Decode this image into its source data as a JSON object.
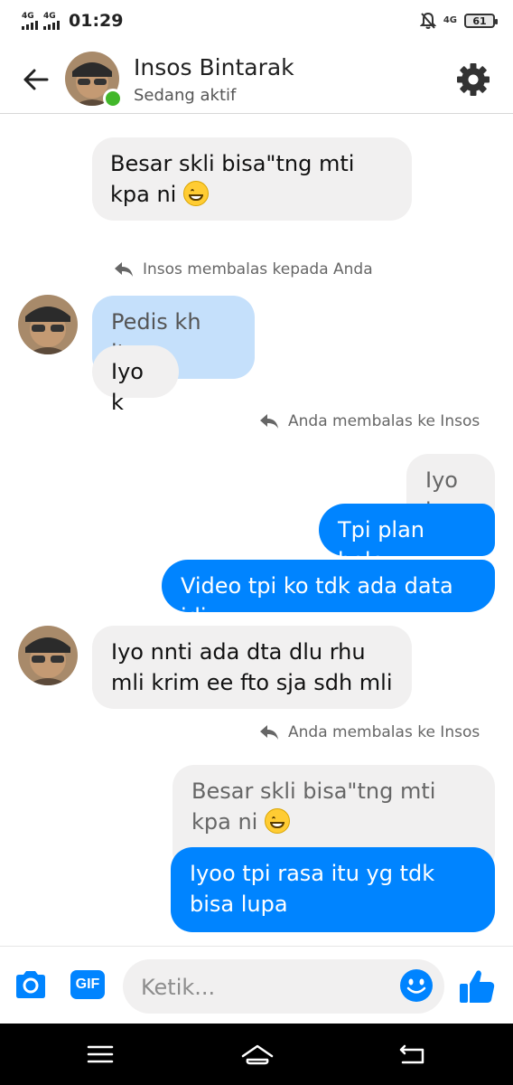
{
  "status_bar": {
    "network_left_1": "4G",
    "network_left_2": "4G",
    "time": "01:29",
    "network_right": "4G",
    "battery": "61"
  },
  "header": {
    "name": "Insos Bintarak",
    "status": "Sedang aktif"
  },
  "messages": {
    "m1": "Besar skli bisa\"tng mti kpa ni",
    "note1": "Insos membalas kepada Anda",
    "m2_quote": "Pedis kh itu",
    "m2": "Iyo k",
    "note2": "Anda membalas ke Insos",
    "m3_quote": "Iyo k",
    "m3a": "Tpi plan bole",
    "m3b": "Video tpi ko tdk ada data jdi",
    "m4": "Iyo nnti ada dta dlu rhu mli krim ee fto sja sdh mli",
    "note3": "Anda membalas ke Insos",
    "m5_quote": "Besar skli bisa\"tng mti kpa ni",
    "m5": "Iyoo tpi rasa itu yg tdk bisa lupa"
  },
  "composer": {
    "placeholder": "Ketik...",
    "gif_label": "GIF"
  },
  "colors": {
    "accent": "#0084ff",
    "online": "#42b72a",
    "quote_blue": "#c5e0fb",
    "bubble_gray": "#f1f0f0"
  },
  "icons": [
    "back-arrow-icon",
    "settings-gear-icon",
    "reply-icon",
    "grin-emoji-icon",
    "camera-icon",
    "gif-icon",
    "emoji-icon",
    "thumbs-up-icon",
    "menu-icon",
    "home-icon",
    "back-icon"
  ]
}
